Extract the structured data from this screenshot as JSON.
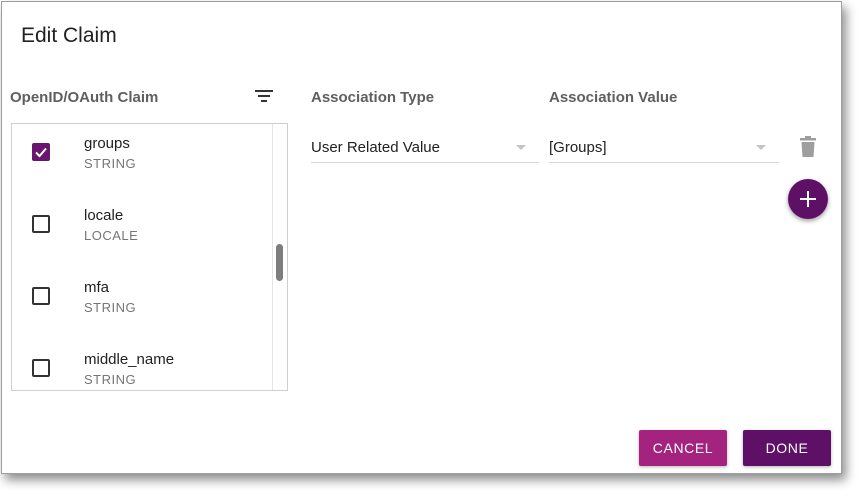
{
  "dialog": {
    "title": "Edit Claim"
  },
  "columns": {
    "claim": "OpenID/OAuth Claim",
    "association_type": "Association Type",
    "association_value": "Association Value"
  },
  "icons": {
    "filter": "filter-icon",
    "check": "check-icon",
    "trash": "trash-icon",
    "add": "plus-icon"
  },
  "claims": [
    {
      "name": "groups",
      "type": "STRING",
      "checked": true
    },
    {
      "name": "locale",
      "type": "LOCALE",
      "checked": false
    },
    {
      "name": "mfa",
      "type": "STRING",
      "checked": false
    },
    {
      "name": "middle_name",
      "type": "STRING",
      "checked": false
    }
  ],
  "association": {
    "type_value": "User Related Value",
    "value_value": "[Groups]"
  },
  "buttons": {
    "cancel": "CANCEL",
    "done": "DONE"
  },
  "colors": {
    "accent": "#6a1570",
    "cancel_button": "#a3237f",
    "done_button": "#5e1066"
  }
}
